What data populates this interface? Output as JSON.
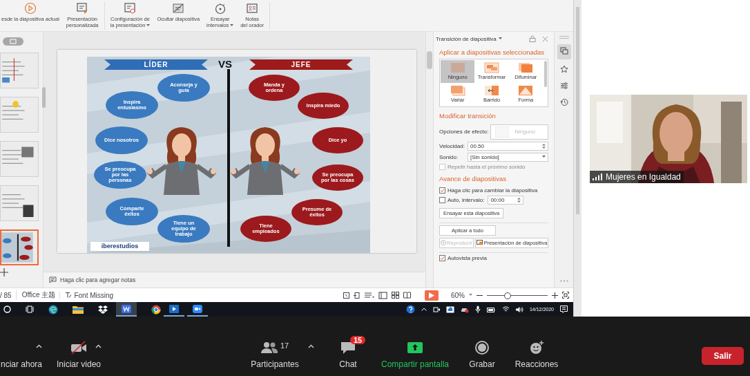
{
  "ribbon": {
    "buttons": [
      {
        "kind": "play",
        "lines": [
          "esde la diapositiva actual"
        ],
        "dropdown": false
      },
      {
        "kind": "custom",
        "lines": [
          "Presentación",
          "personalizada"
        ],
        "dropdown": false
      },
      {
        "kind": "setup",
        "lines": [
          "Configuración de",
          "la presentación"
        ],
        "dropdown": true
      },
      {
        "kind": "hide",
        "lines": [
          "Ocultar diapositiva"
        ],
        "dropdown": false
      },
      {
        "kind": "timer",
        "lines": [
          "Ensayar",
          "intervalos"
        ],
        "dropdown": true
      },
      {
        "kind": "notes",
        "lines": [
          "Notas",
          "del orador"
        ],
        "dropdown": false
      }
    ]
  },
  "slide_panel": {
    "thumbnails": [
      {
        "selected": false
      },
      {
        "selected": false
      },
      {
        "selected": false
      },
      {
        "selected": false
      },
      {
        "selected": true
      }
    ]
  },
  "slide": {
    "left_title": "LÍDER",
    "versus": "VS",
    "right_title": "JEFE",
    "leader_traits": [
      "Aconseja y guía",
      "Inspira entusiasmo",
      "Dice nosotros",
      "Se preocupa por las personas",
      "Comparte éxitos",
      "Tiene un equipo de trabajo"
    ],
    "boss_traits": [
      "Manda y ordena",
      "Inspira miedo",
      "Dice yo",
      "Se preocupa por las cosas",
      "Presume de éxitos",
      "Tiene empleados"
    ],
    "logo": "iberestudios"
  },
  "notes": {
    "placeholder": "Haga clic para agregar notas"
  },
  "task_pane": {
    "title": "Transición de diapositiva",
    "apply_heading": "Aplicar a diapositivas seleccionadas",
    "effects": [
      {
        "label": "Ninguno",
        "selected": true
      },
      {
        "label": "Transformar",
        "selected": false
      },
      {
        "label": "Difuminar",
        "selected": false
      },
      {
        "label": "Variar",
        "selected": false
      },
      {
        "label": "Barrido",
        "selected": false
      },
      {
        "label": "Forma",
        "selected": false
      }
    ],
    "modify_heading": "Modificar transición",
    "effect_options": {
      "label": "Opciones de efecto:",
      "value": "Ninguno"
    },
    "speed": {
      "label": "Velocidad:",
      "value": "00.50"
    },
    "sound": {
      "label": "Sonido:",
      "value": "[Sin sonido]"
    },
    "loop": {
      "label": "Repetir hasta el próximo sonido",
      "checked": false,
      "disabled": true
    },
    "advance_heading": "Avance de diapositivas",
    "on_click": {
      "label": "Haga clic para cambiar la diapositiva",
      "checked": true
    },
    "auto": {
      "label": "Auto, intervalo:",
      "checked": false,
      "value": "00:00"
    },
    "rehearse_button": "Ensayar esta diapositiva",
    "apply_all_button": "Aplicar a todo",
    "play_button": {
      "label": "Reproducir",
      "disabled": true
    },
    "slideshow_button": "Presentación de diapositiva",
    "autopreview": {
      "label": "Autovista previa",
      "checked": true
    }
  },
  "status_bar": {
    "slide_count": "/ 85",
    "theme": "Office 主题",
    "font_status": "Font Missing",
    "zoom": "60%",
    "zoom_slider": {
      "level": 0.33
    }
  },
  "taskbar": {
    "date": "14/12/2020"
  },
  "video_tile": {
    "name": "Mujeres en Igualdad"
  },
  "meeting_controls": {
    "items": [
      {
        "kind": "mic",
        "label": "nciar ahora"
      },
      {
        "kind": "video",
        "label": "Iniciar video",
        "off": true
      },
      {
        "kind": "participants",
        "label": "Participantes",
        "count": "17"
      },
      {
        "kind": "chat",
        "label": "Chat",
        "badge": "15"
      },
      {
        "kind": "share",
        "label": "Compartir pantalla"
      },
      {
        "kind": "record",
        "label": "Grabar"
      },
      {
        "kind": "reactions",
        "label": "Reacciones"
      }
    ],
    "leave_button": "Salir"
  }
}
